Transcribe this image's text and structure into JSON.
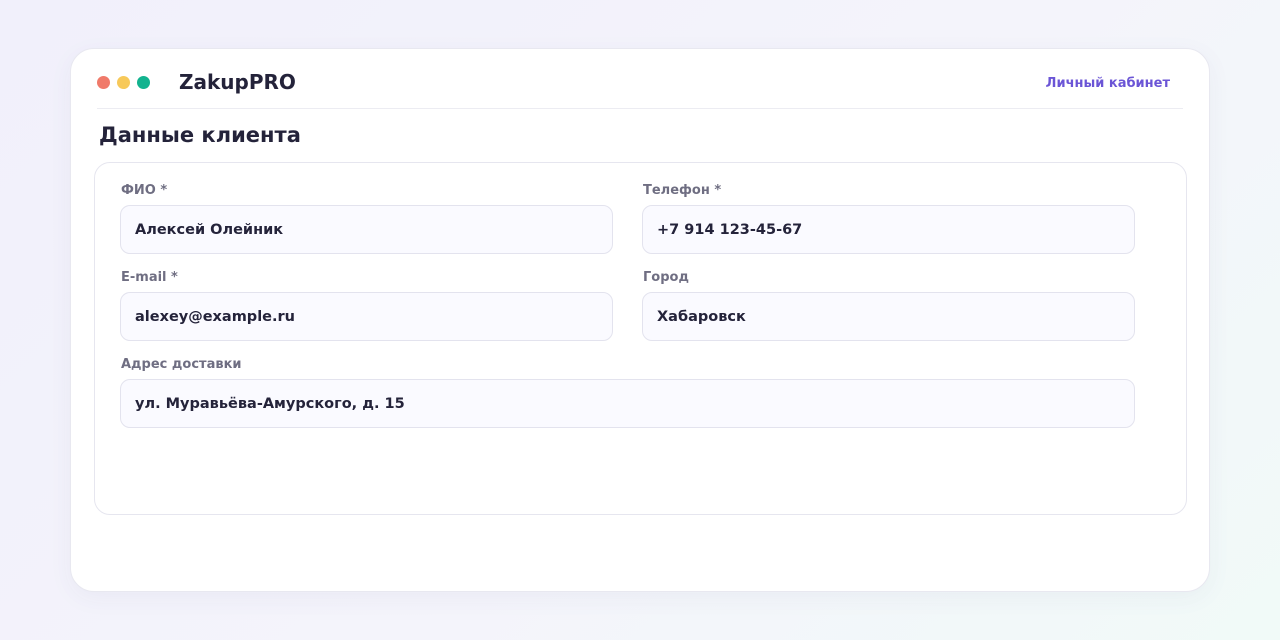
{
  "header": {
    "window_controls": [
      "close",
      "minimize",
      "maximize"
    ],
    "app_title": "ZakupPRO",
    "account_link": "Личный кабинет"
  },
  "section": {
    "title": "Данные клиента"
  },
  "form": {
    "full_name": {
      "label": "ФИО *",
      "value": "Алексей Олейник"
    },
    "phone": {
      "label": "Телефон *",
      "value": "+7 914 123-45-67"
    },
    "email": {
      "label": "E-mail *",
      "value": "alexey@example.ru"
    },
    "city": {
      "label": "Город",
      "value": "Хабаровск"
    },
    "address": {
      "label": "Адрес доставки",
      "value": "ул. Муравьёва-Амурского, д. 15"
    }
  },
  "colors": {
    "accent": "#6b55d6",
    "dot_red": "#f07a6a",
    "dot_yellow": "#f7c95a",
    "dot_green": "#12b38f",
    "text_primary": "#24233a",
    "text_label": "#6f6e82"
  }
}
